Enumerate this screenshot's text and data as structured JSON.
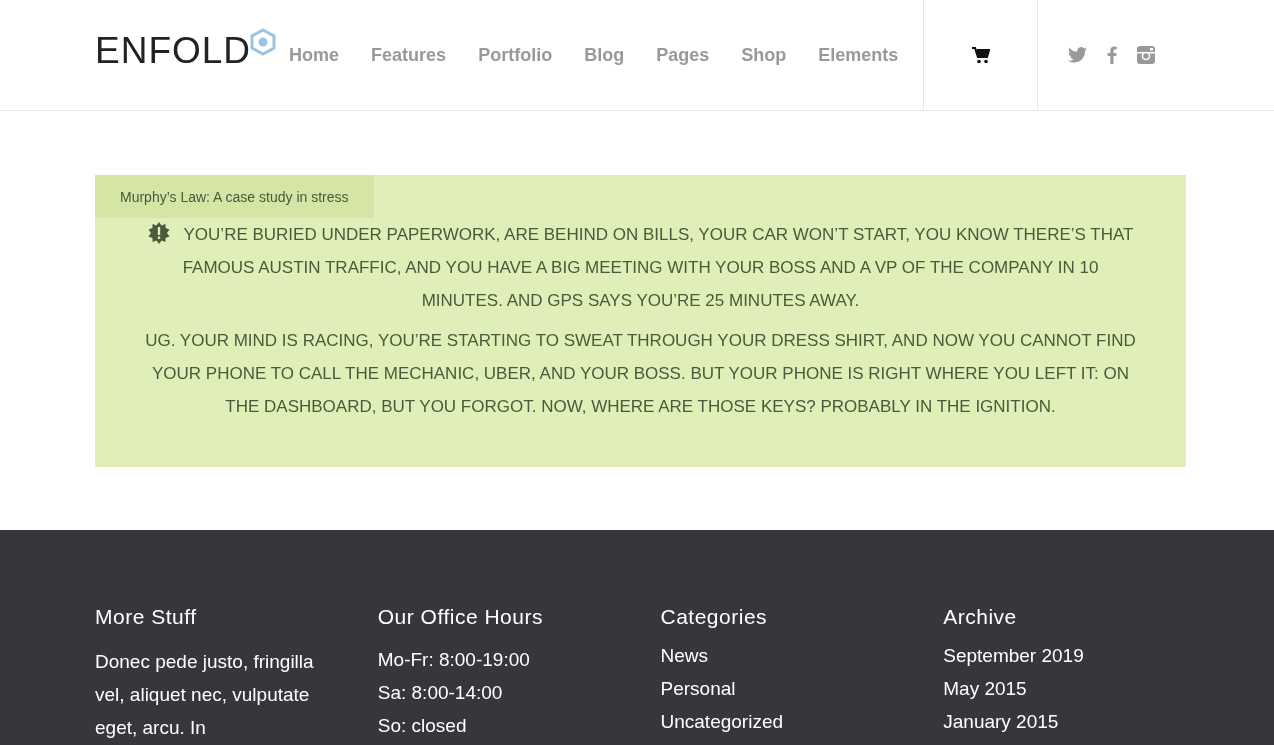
{
  "logo": "ENFOLD",
  "nav": [
    {
      "label": "Home"
    },
    {
      "label": "Features"
    },
    {
      "label": "Portfolio"
    },
    {
      "label": "Blog"
    },
    {
      "label": "Pages"
    },
    {
      "label": "Shop"
    },
    {
      "label": "Elements"
    }
  ],
  "notice": {
    "title": "Murphy’s Law: A case study in stress",
    "paragraphs": [
      "YOU’RE BURIED UNDER PAPERWORK, ARE BEHIND ON BILLS, YOUR CAR WON’T START, YOU KNOW THERE’S THAT FAMOUS AUSTIN TRAFFIC, AND YOU HAVE A BIG MEETING WITH YOUR BOSS AND A VP OF THE COMPANY IN 10 MINUTES. AND GPS SAYS YOU’RE 25 MINUTES AWAY.",
      "UG. YOUR MIND IS RACING, YOU’RE STARTING TO SWEAT THROUGH YOUR DRESS SHIRT, AND NOW YOU CANNOT FIND YOUR PHONE TO CALL THE MECHANIC, UBER, AND YOUR BOSS. BUT YOUR PHONE IS RIGHT WHERE YOU LEFT IT: ON THE DASHBOARD, BUT YOU FORGOT. NOW, WHERE ARE THOSE KEYS? PROBABLY IN THE IGNITION."
    ]
  },
  "footer": [
    {
      "heading": "More Stuff",
      "kind": "text",
      "text": "Donec pede justo, fringilla vel, aliquet nec, vulputate eget, arcu. In"
    },
    {
      "heading": "Our Office Hours",
      "kind": "lines",
      "items": [
        "Mo-Fr: 8:00-19:00",
        "Sa: 8:00-14:00",
        "So: closed"
      ]
    },
    {
      "heading": "Categories",
      "kind": "links",
      "items": [
        "News",
        "Personal",
        "Uncategorized"
      ]
    },
    {
      "heading": "Archive",
      "kind": "links",
      "items": [
        "September 2019",
        "May 2015",
        "January 2015"
      ]
    }
  ]
}
